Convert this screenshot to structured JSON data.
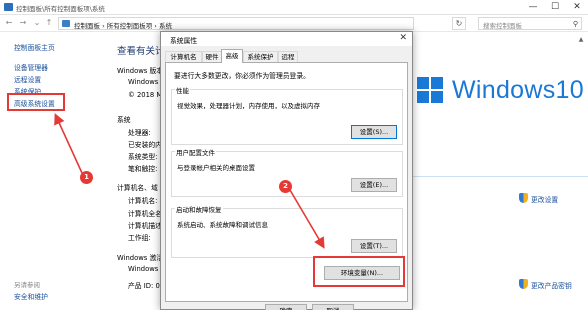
{
  "window": {
    "title": "控制面板\\所有控制面板项\\系统",
    "minimize": "—",
    "maximize": "☐",
    "close": "✕"
  },
  "address": {
    "path": "控制面板  ›  所有控制面板项  ›  系统",
    "search_placeholder": "搜索控制面板"
  },
  "sidebar": {
    "home": "控制面板主页",
    "items": [
      "设备管理器",
      "远程设置",
      "系统保护",
      "高级系统设置"
    ],
    "see_also": "另请参阅",
    "security": "安全和维护"
  },
  "main": {
    "heading": "查看有关计",
    "edition_label": "Windows 版本",
    "edition_lines": [
      "Windows",
      "© 2018 Mi"
    ],
    "system_section": "系统",
    "system_rows": [
      "处理器:",
      "已安装的内",
      "系统类型:",
      "笔和触控:"
    ],
    "computer_section": "计算机名、域",
    "computer_rows": [
      "计算机名:",
      "计算机全名",
      "计算机描述",
      "工作组:"
    ],
    "activation_section": "Windows 激活",
    "activation_rows": [
      "Windows",
      "产品 ID: 00"
    ],
    "windows_logo_text": "Windows10",
    "change_settings": "更改设置",
    "change_key": "更改产品密钥"
  },
  "dialog": {
    "title": "系统属性",
    "tabs": [
      "计算机名",
      "硬件",
      "高级",
      "系统保护",
      "远程"
    ],
    "active_tab_index": 2,
    "admin_note": "要进行大多数更改，你必须作为管理员登录。",
    "performance": {
      "label": "性能",
      "desc": "视觉效果，处理器计划，内存使用，以及虚拟内存",
      "button": "设置(S)..."
    },
    "profiles": {
      "label": "用户配置文件",
      "desc": "与登录帐户相关的桌面设置",
      "button": "设置(E)..."
    },
    "startup": {
      "label": "启动和故障恢复",
      "desc": "系统启动、系统故障和调试信息",
      "button": "设置(T)..."
    },
    "env_button": "环境变量(N)...",
    "ok_button": "确定",
    "cancel_button": "取消"
  },
  "annotations": {
    "step1": "1",
    "step2": "2",
    "color": "#e53935"
  },
  "colors": {
    "link": "#1a4f9c",
    "windows_blue": "#1a78d6",
    "heading": "#1e3d73"
  }
}
